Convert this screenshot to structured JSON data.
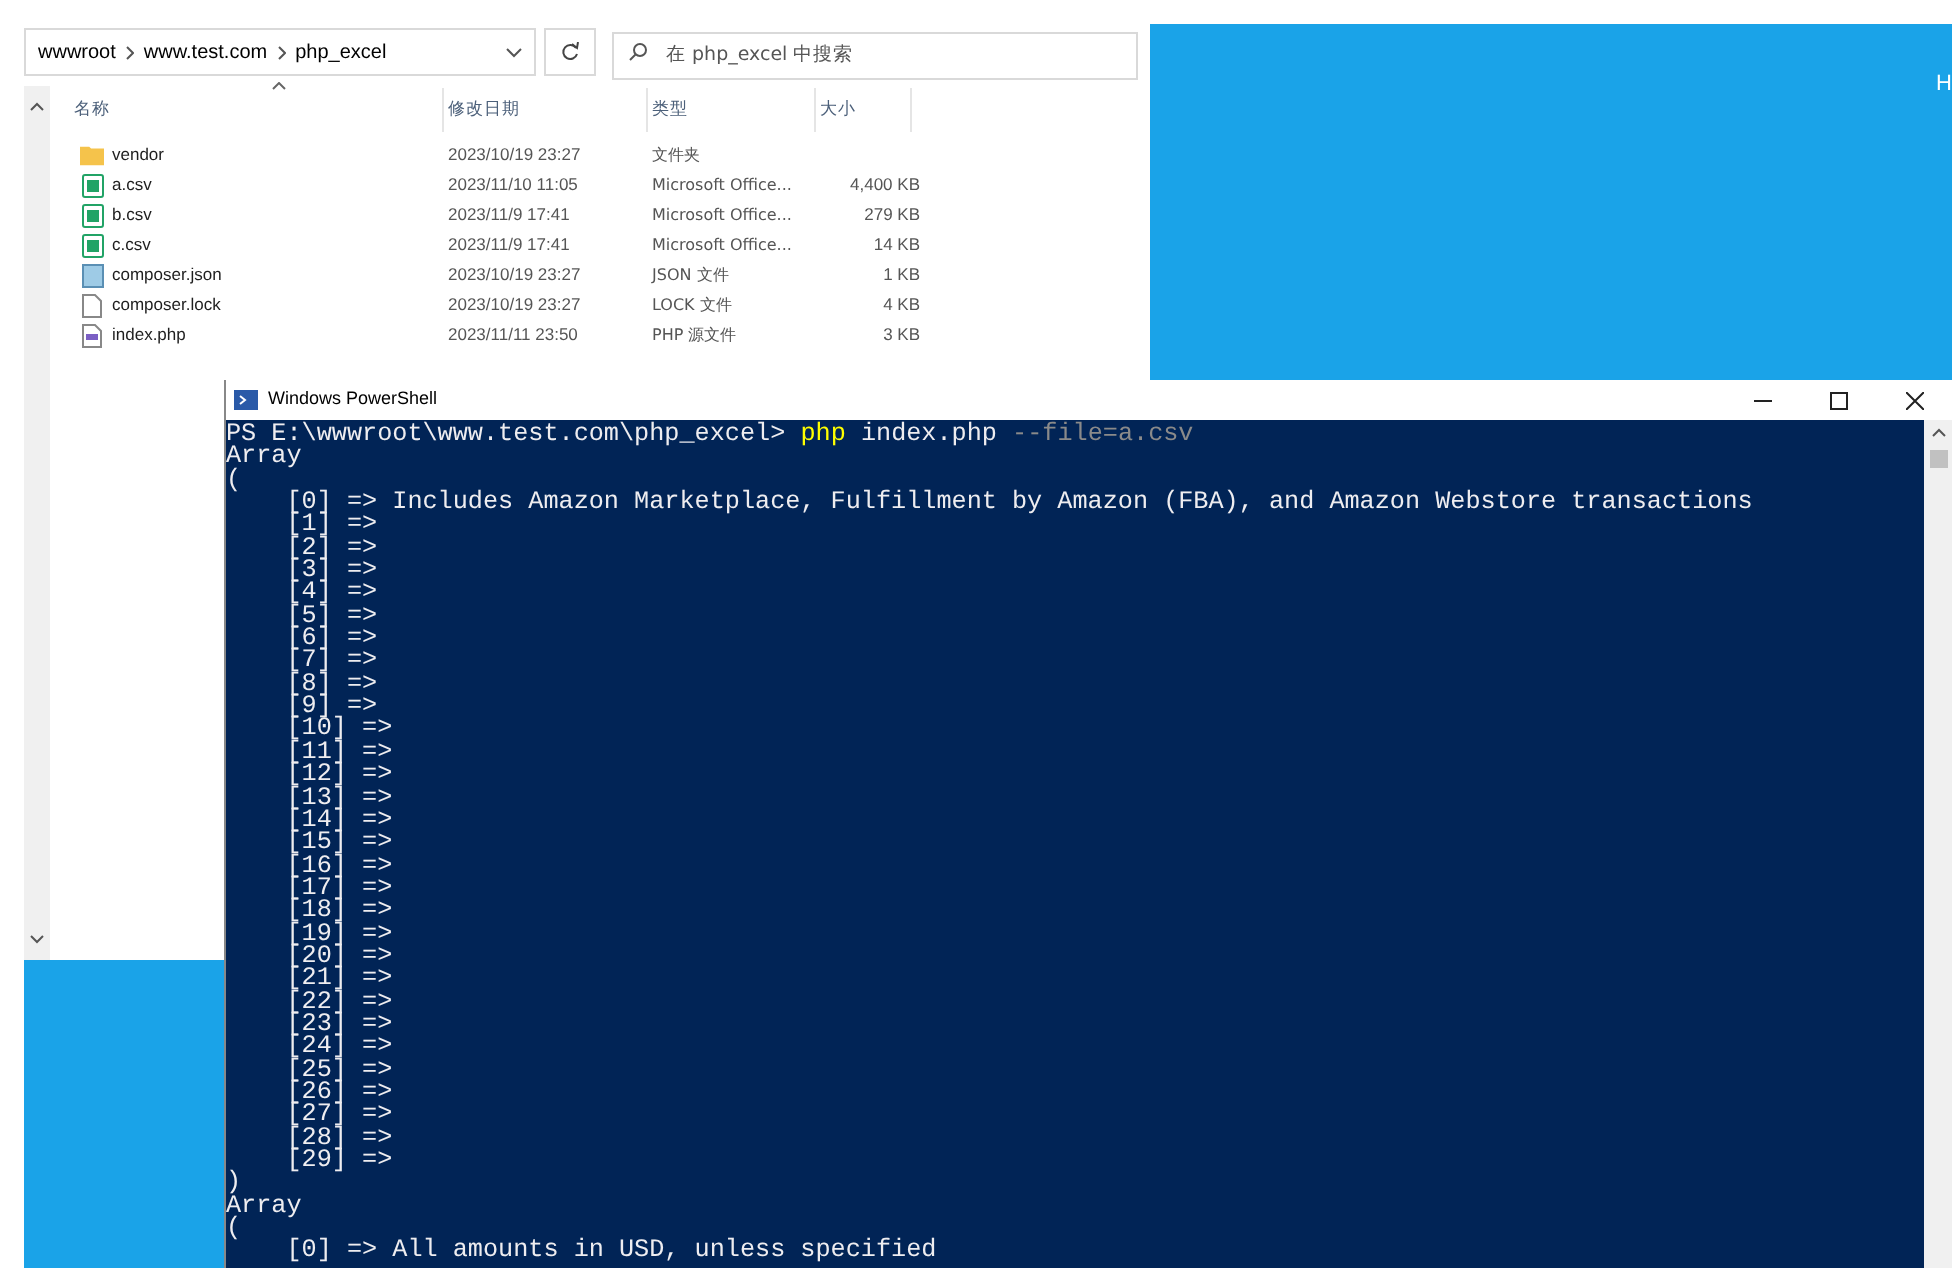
{
  "explorer": {
    "breadcrumb": [
      "wwwroot",
      "www.test.com",
      "php_excel"
    ],
    "search": {
      "placeholder": "在 php_excel 中搜索"
    },
    "columns": [
      "名称",
      "修改日期",
      "类型",
      "大小"
    ],
    "files": [
      {
        "kind": "folder",
        "name": "vendor",
        "modified": "2023/10/19 23:27",
        "type": "文件夹"
      },
      {
        "kind": "csv",
        "name": "a.csv",
        "modified": "2023/11/10 11:05",
        "type": "Microsoft Office...",
        "size": "4,400 KB"
      },
      {
        "kind": "csv",
        "name": "b.csv",
        "modified": "2023/11/9 17:41",
        "type": "Microsoft Office...",
        "size": "279 KB"
      },
      {
        "kind": "csv",
        "name": "c.csv",
        "modified": "2023/11/9 17:41",
        "type": "Microsoft Office...",
        "size": "14 KB"
      },
      {
        "kind": "json",
        "name": "composer.json",
        "modified": "2023/10/19 23:27",
        "type": "JSON 文件",
        "size": "1 KB"
      },
      {
        "kind": "lock",
        "name": "composer.lock",
        "modified": "2023/10/19 23:27",
        "type": "LOCK 文件",
        "size": "4 KB"
      },
      {
        "kind": "php",
        "name": "index.php",
        "modified": "2023/11/11 23:50",
        "type": "PHP 源文件",
        "size": "3 KB"
      }
    ]
  },
  "desktop": {
    "label": "H"
  },
  "powershell": {
    "title": "Windows PowerShell",
    "prompt": {
      "path": "PS E:\\wwwroot\\www.test.com\\php_excel>",
      "command": "php",
      "argument": "index.php",
      "option": "--file=a.csv"
    },
    "output": [
      "Array",
      "(",
      "    [0] => Includes Amazon Marketplace, Fulfillment by Amazon (FBA), and Amazon Webstore transactions",
      "    [1] =>",
      "    [2] =>",
      "    [3] =>",
      "    [4] =>",
      "    [5] =>",
      "    [6] =>",
      "    [7] =>",
      "    [8] =>",
      "    [9] =>",
      "    [10] =>",
      "    [11] =>",
      "    [12] =>",
      "    [13] =>",
      "    [14] =>",
      "    [15] =>",
      "    [16] =>",
      "    [17] =>",
      "    [18] =>",
      "    [19] =>",
      "    [20] =>",
      "    [21] =>",
      "    [22] =>",
      "    [23] =>",
      "    [24] =>",
      "    [25] =>",
      "    [26] =>",
      "    [27] =>",
      "    [28] =>",
      "    [29] =>",
      ")",
      "Array",
      "(",
      "    [0] => All amounts in USD, unless specified"
    ]
  }
}
